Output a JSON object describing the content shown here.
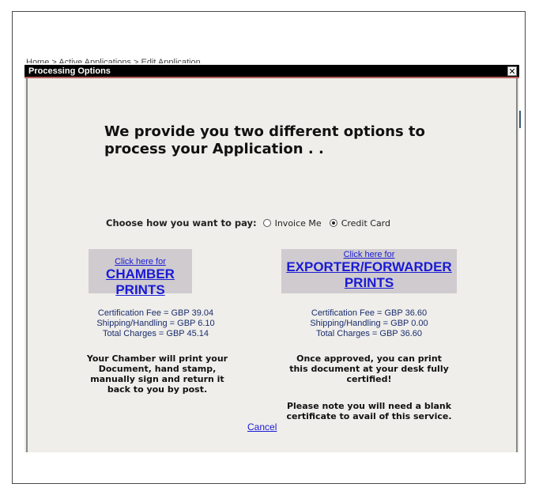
{
  "background": {
    "breadcrumb_text": "Home  >  Active Applications  >  Edit Application"
  },
  "dialog": {
    "title": "Processing Options",
    "close_glyph": "✕",
    "heading": "We provide you two different options to process your Application . .",
    "payment": {
      "question": "Choose how you want to pay:",
      "options": [
        {
          "label": "Invoice Me",
          "selected": false
        },
        {
          "label": "Credit Card",
          "selected": true
        }
      ]
    },
    "chamber": {
      "link_small": "Click here for",
      "link_big": "CHAMBER PRINTS",
      "fees": [
        "Certification Fee = GBP 39.04",
        "Shipping/Handling = GBP 6.10",
        "Total Charges = GBP 45.14"
      ],
      "description": "Your Chamber will print your Document, hand stamp, manually sign and return it back to you by post."
    },
    "exporter": {
      "link_small": "Click here for",
      "link_big": "EXPORTER/FORWARDER PRINTS",
      "fees": [
        "Certification Fee = GBP 36.60",
        "Shipping/Handling = GBP 0.00",
        "Total Charges = GBP 36.60"
      ],
      "description": "Once approved, you can print this document at your desk fully certified!",
      "note": "Please note you will need a blank certificate to avail of this service."
    },
    "cancel_label": "Cancel"
  }
}
